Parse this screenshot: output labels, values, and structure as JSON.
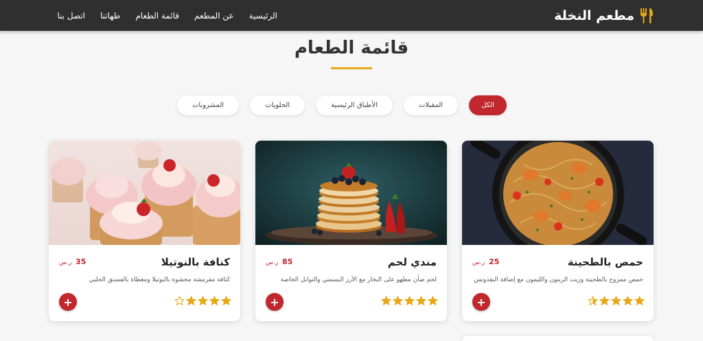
{
  "header": {
    "brand": "مطعم النخلة",
    "brand_icon": "utensils-icon",
    "nav": [
      "الرئيسية",
      "عن المطعم",
      "قائمة الطعام",
      "طهاتنا",
      "اتصل بنا"
    ]
  },
  "section": {
    "title": "قائمة الطعام"
  },
  "filters": [
    {
      "label": "الكل",
      "active": true
    },
    {
      "label": "المقبلات",
      "active": false
    },
    {
      "label": "الأطباق الرئيسية",
      "active": false
    },
    {
      "label": "الحلويات",
      "active": false
    },
    {
      "label": "المشروبات",
      "active": false
    }
  ],
  "items": [
    {
      "name": "حمص بالطحينة",
      "price": "25",
      "currency": "ر.س",
      "description": "حمص ممزوج بالطحينة وزيت الزيتون والليمون مع إضافة البقدونس",
      "rating": 4.5,
      "image": "seafood-pasta-pan"
    },
    {
      "name": "مندي لحم",
      "price": "85",
      "currency": "ر.س",
      "description": "لحم ضأن مطهو على البخار مع الأرز البسمتي والتوابل الخاصة",
      "rating": 5,
      "image": "pancake-stack"
    },
    {
      "name": "كنافة بالنوتيلا",
      "price": "35",
      "currency": "ر.س",
      "description": "كنافة مقرمشة محشوة بالنوتيلا ومغطاة بالفستق الحلبي",
      "rating": 4,
      "image": "strawberry-cupcakes"
    }
  ],
  "add_button_symbol": "+",
  "colors": {
    "accent_red": "#c0282d",
    "gold": "#e6a817",
    "header_bg": "#2f2f2f"
  }
}
